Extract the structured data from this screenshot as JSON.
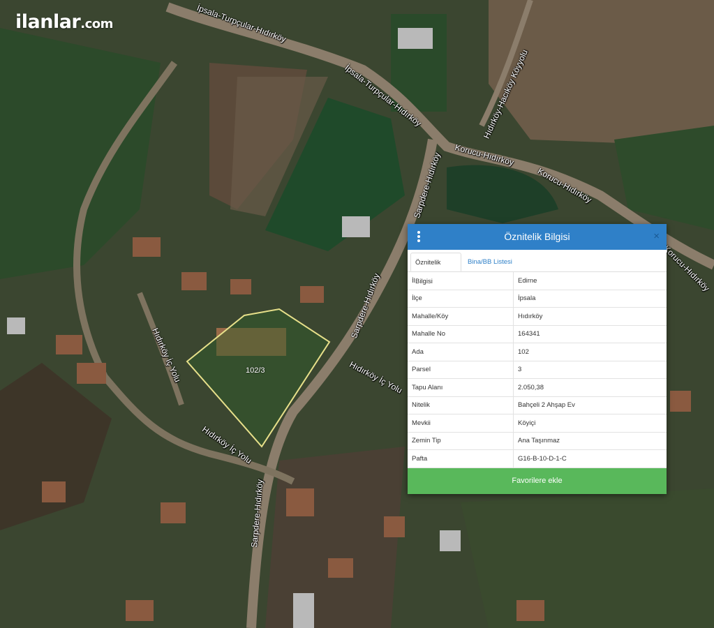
{
  "brand": {
    "name": "ilanlar",
    "domain": ".com"
  },
  "map": {
    "road_labels": [
      "İpsala-Turpçular-Hıdırköy",
      "İpsala-Turpçular-Hıdırköy",
      "Hıdırköy-Hacıköy Köyyolu",
      "Korucu-Hıdırköy",
      "Korucu-Hıdırköy",
      "Korucu-Hıdırköy",
      "Sarpdere-Hıdırköy",
      "Sarpdere-Hıdırköy",
      "Sarpdere-Hıdırköy",
      "Hıdırköy İç Yolu",
      "Hıdırköy İç Yolu",
      "Hıdırköy İç Yolu"
    ],
    "parcel_label": "102/3"
  },
  "panel": {
    "title": "Öznitelik Bilgisi",
    "close_label": "×",
    "tabs": [
      "Öznitelik Bilgisi",
      "Bina/BB Listesi"
    ],
    "rows": [
      {
        "key": "İl",
        "value": "Edirne"
      },
      {
        "key": "İlçe",
        "value": "İpsala"
      },
      {
        "key": "Mahalle/Köy",
        "value": "Hıdırköy"
      },
      {
        "key": "Mahalle No",
        "value": "164341"
      },
      {
        "key": "Ada",
        "value": "102"
      },
      {
        "key": "Parsel",
        "value": "3"
      },
      {
        "key": "Tapu Alanı",
        "value": "2.050,38"
      },
      {
        "key": "Nitelik",
        "value": "Bahçeli 2 Ahşap Ev"
      },
      {
        "key": "Mevkii",
        "value": "Köyiçi"
      },
      {
        "key": "Zemin Tip",
        "value": "Ana Taşınmaz"
      },
      {
        "key": "Pafta",
        "value": "G16-B-10-D-1-C"
      }
    ],
    "favorite_button": "Favorilere ekle",
    "colors": {
      "header": "#2f80c8",
      "button": "#59b85b",
      "parcel_outline": "#e7e08a"
    }
  }
}
